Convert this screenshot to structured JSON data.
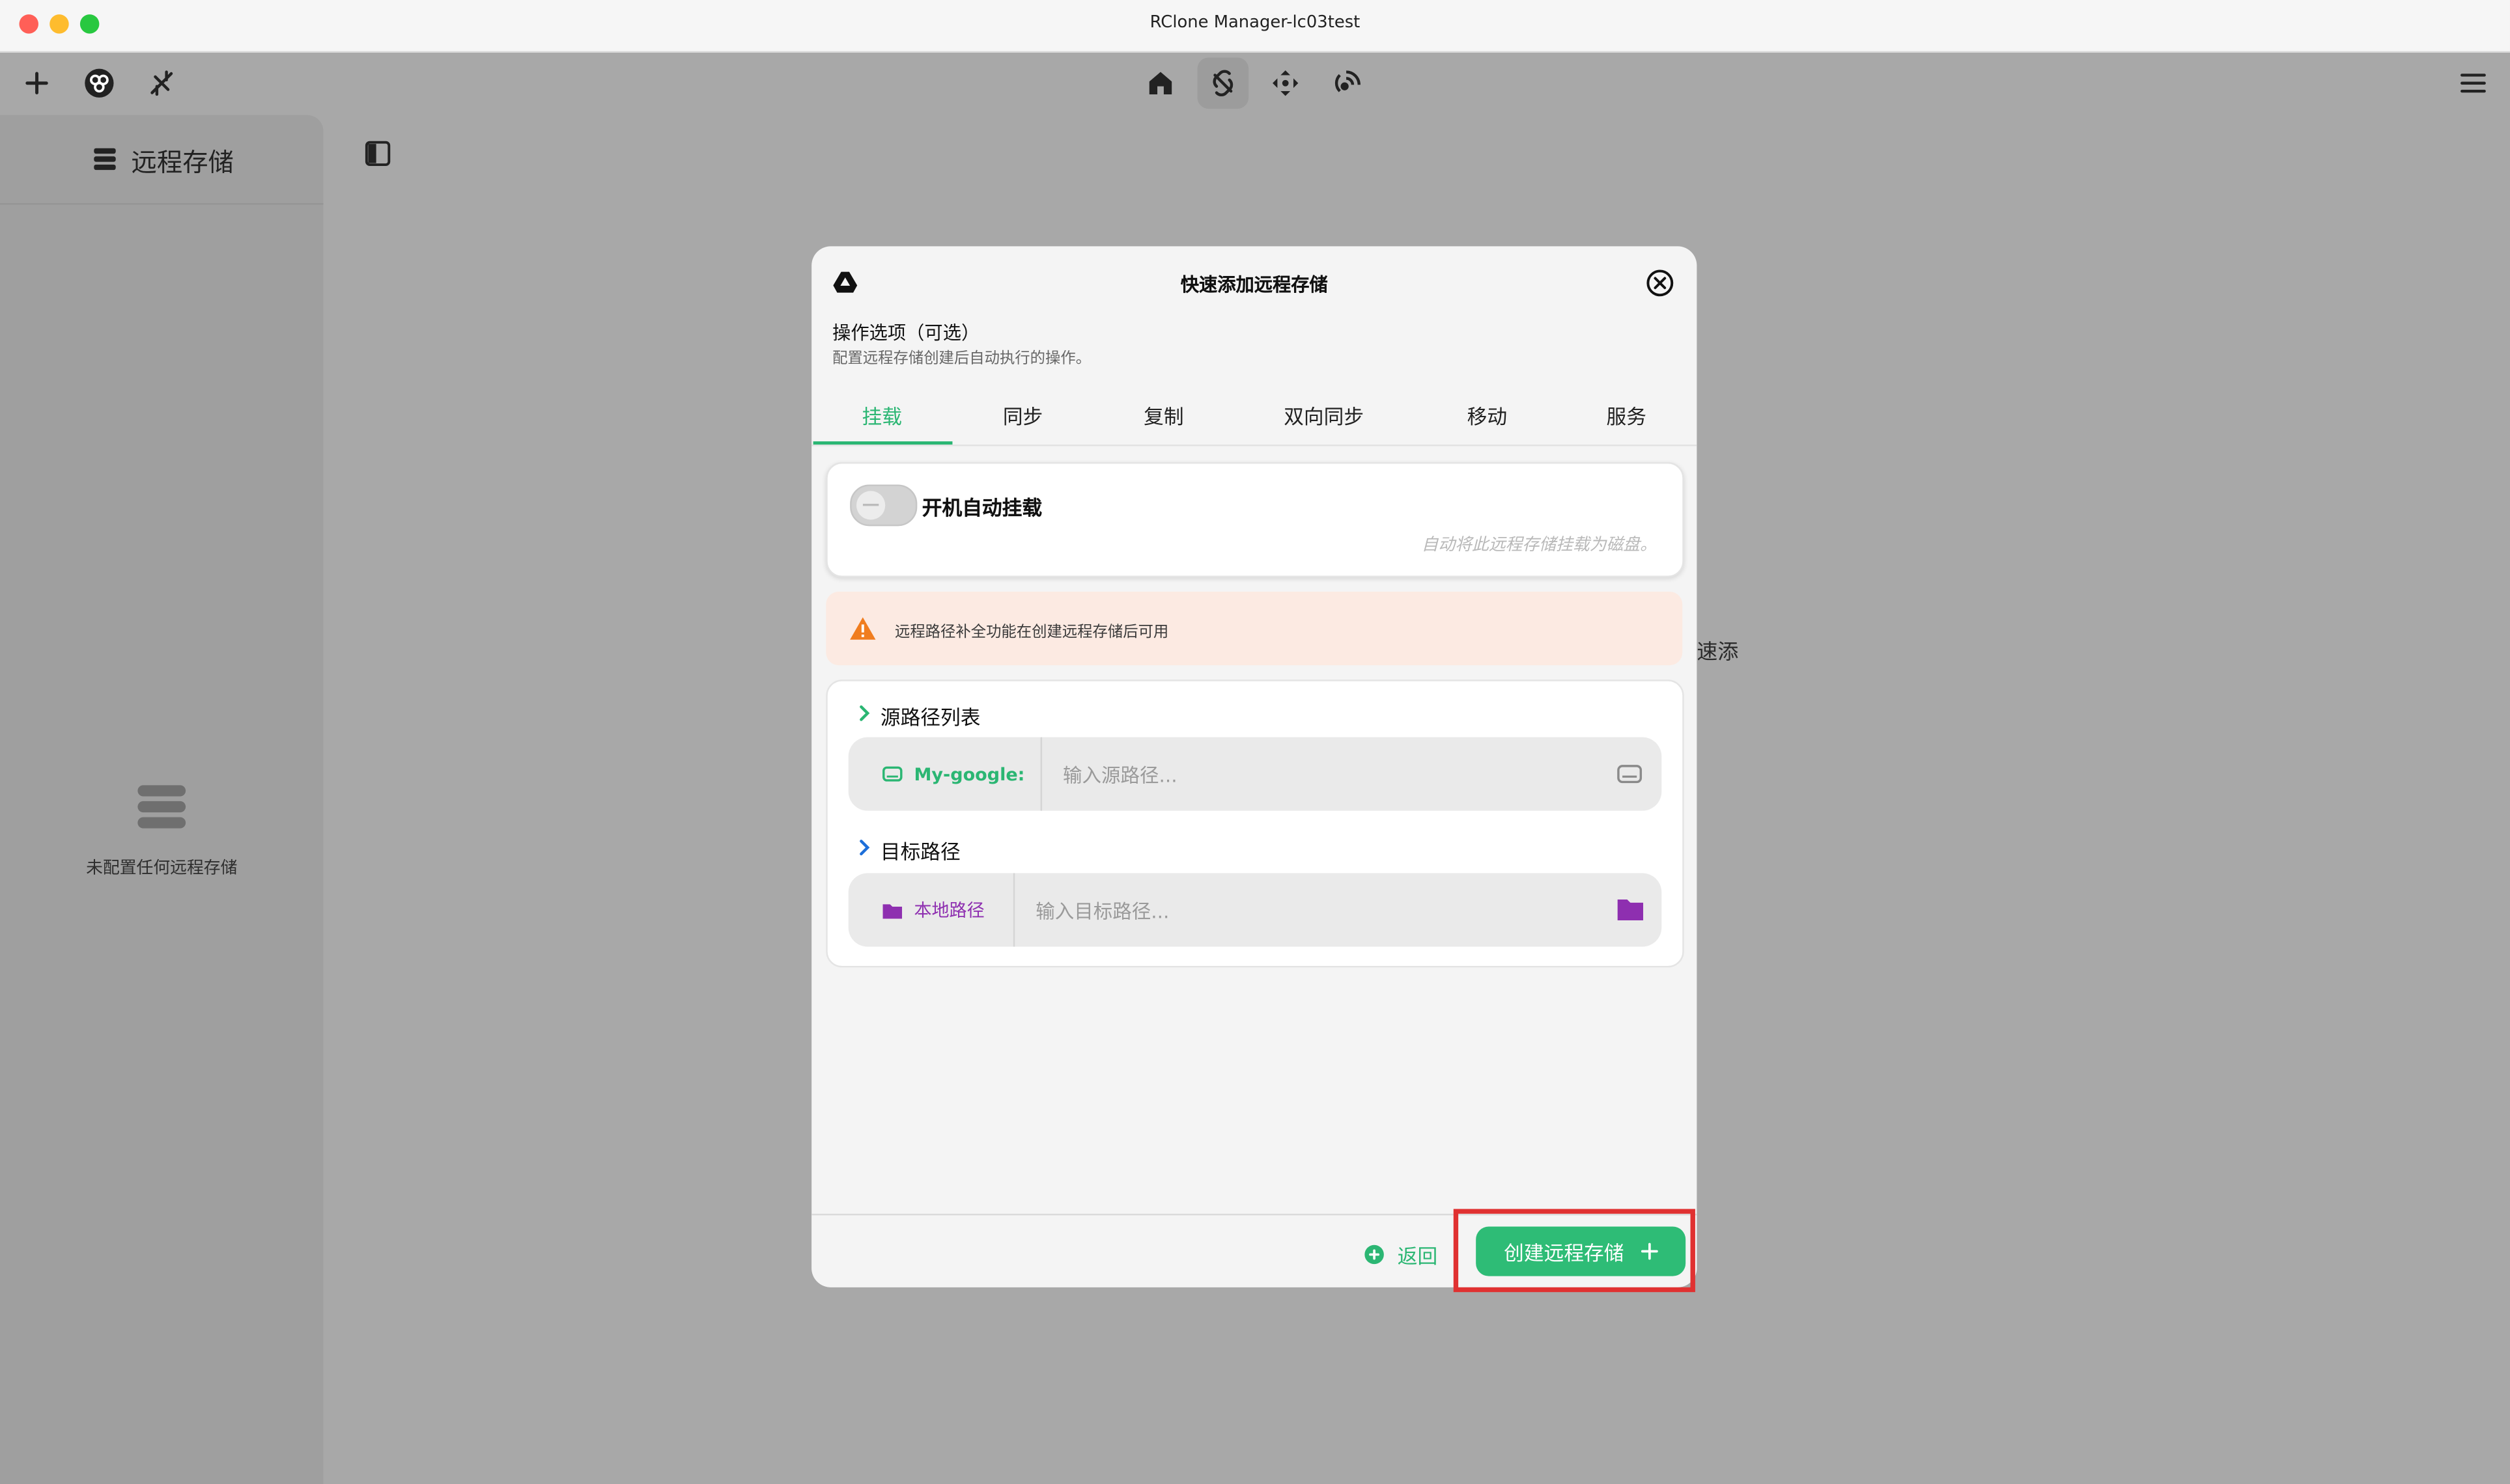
{
  "window": {
    "title": "RClone Manager-lc03test",
    "traffic_colors": [
      "#ff5f57",
      "#febc2e",
      "#28c840"
    ]
  },
  "toolbar": {
    "left_icons": [
      "plus-icon",
      "rclone-logo-icon",
      "no-connection-icon"
    ],
    "nav_icons": [
      "home-icon",
      "mount-icon",
      "sync-icon",
      "serve-icon"
    ],
    "active_nav": "mount-icon",
    "menu_icon": "hamburger-menu-icon"
  },
  "sidebar": {
    "title": "远程存储",
    "empty_text": "未配置任何远程存储"
  },
  "background": {
    "partial_text": "速添"
  },
  "modal": {
    "title": "快速添加远程存储",
    "options_title": "操作选项（可选）",
    "options_desc": "配置远程存储创建后自动执行的操作。",
    "tabs": [
      "挂载",
      "同步",
      "复制",
      "双向同步",
      "移动",
      "服务"
    ],
    "active_tab": "挂载",
    "auto_mount": {
      "label": "开机自动挂载",
      "description": "自动将此远程存储挂载为磁盘。",
      "enabled": false
    },
    "alert": {
      "text": "远程路径补全功能在创建远程存储后可用"
    },
    "source": {
      "title": "源路径列表",
      "chip_label": "My-google:",
      "placeholder": "输入源路径..."
    },
    "target": {
      "title": "目标路径",
      "chip_label": "本地路径",
      "placeholder": "输入目标路径..."
    },
    "footer": {
      "back_label": "返回",
      "create_label": "创建远程存储"
    }
  },
  "colors": {
    "accent_green": "#2bb673",
    "local_purple": "#8e2fb0",
    "warning_orange": "#f07d1f",
    "highlight_red": "#e03131"
  }
}
